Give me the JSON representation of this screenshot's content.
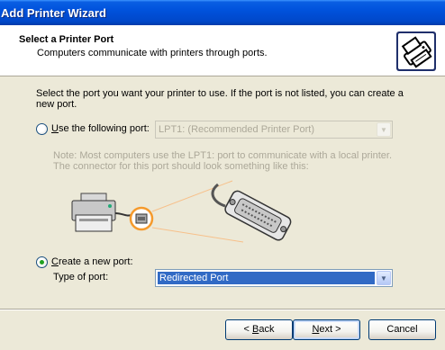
{
  "window": {
    "title": "Add Printer Wizard"
  },
  "header": {
    "title": "Select a Printer Port",
    "subtitle": "Computers communicate with printers through ports.",
    "icon": "printer-wizard-icon"
  },
  "instructions": "Select the port you want your printer to use.  If the port is not listed, you can create a new port.",
  "option_existing": {
    "label_accel": "U",
    "label_rest": "se the following port:",
    "selected": false,
    "port_value": "LPT1: (Recommended Printer Port)",
    "enabled": false
  },
  "note": "Note: Most computers use the LPT1: port to communicate with a local printer. The connector for this port should look something like this:",
  "option_new": {
    "label_accel": "C",
    "label_rest": "reate a new port:",
    "selected": true,
    "type_label": "Type of port:",
    "type_value": "Redirected Port"
  },
  "buttons": {
    "back_accel": "B",
    "back_rest": "ack",
    "back_prefix": "< ",
    "next_accel": "N",
    "next_rest": "ext >",
    "cancel": "Cancel"
  },
  "colors": {
    "titlebar": "#0052dc",
    "selection": "#316ac5",
    "radio_dot": "#21a121",
    "highlight_circle": "#f59a2c"
  }
}
